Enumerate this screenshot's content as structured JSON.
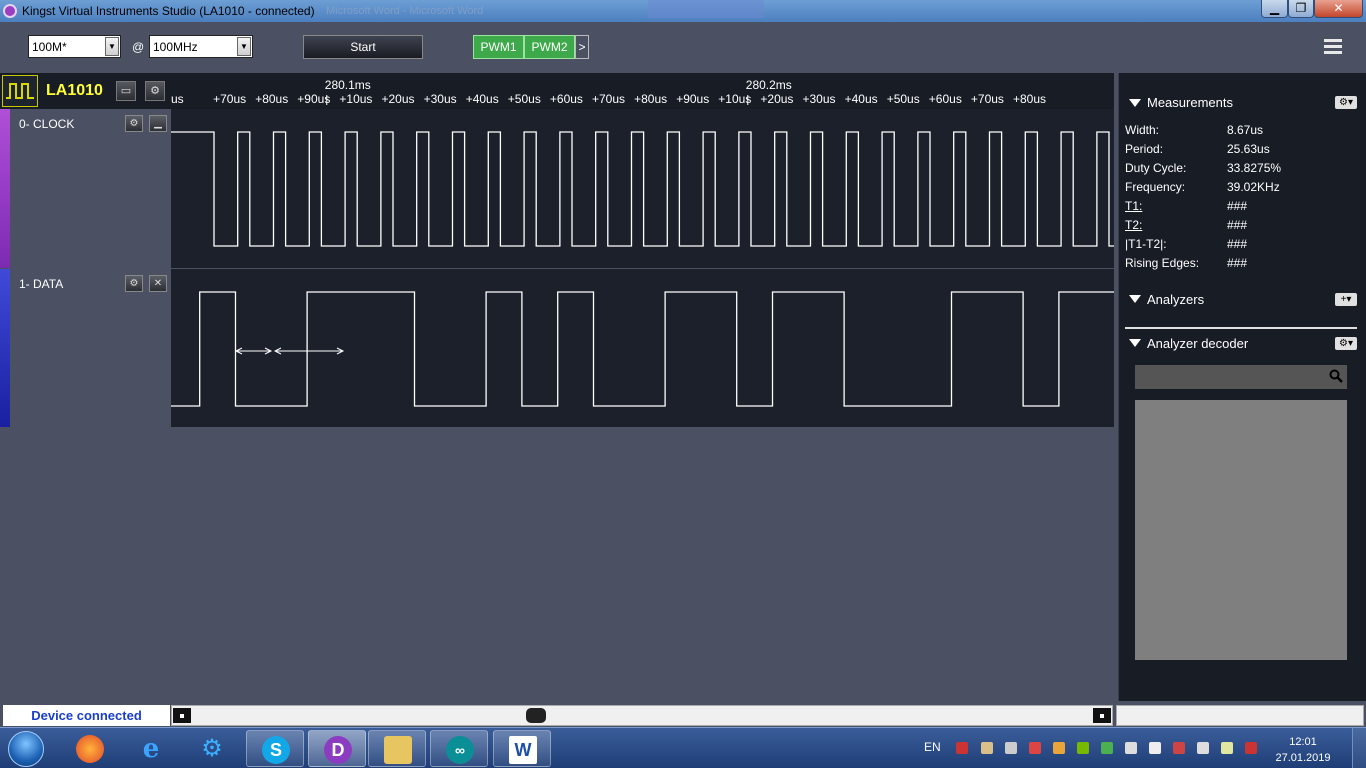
{
  "window": {
    "title": "Kingst Virtual Instruments Studio (LA1010 - connected)",
    "background_ghost_title": "Microsoft Word - Microsoft Word",
    "minimize_label": "▁",
    "maximize_label": "❐",
    "close_label": "✕"
  },
  "toolbar": {
    "sample_depth": "100M*",
    "at_label": "@",
    "sample_rate": "100MHz",
    "start_label": "Start",
    "pwm1_label": "PWM1",
    "pwm2_label": "PWM2",
    "more_label": ">"
  },
  "device": {
    "name": "LA1010"
  },
  "timeline": {
    "ticks": [
      "us",
      "+70us",
      "+80us",
      "+90us",
      "+10us",
      "+20us",
      "+30us",
      "+40us",
      "+50us",
      "+60us",
      "+70us",
      "+80us",
      "+90us",
      "+10us",
      "+20us",
      "+30us",
      "+40us",
      "+50us",
      "+60us",
      "+70us",
      "+80us"
    ],
    "major": [
      "280.1ms",
      "280.2ms"
    ]
  },
  "channels": [
    {
      "label": "0-  CLOCK",
      "color": "#9b3fc2"
    },
    {
      "label": "1-  DATA",
      "color": "#2a35c8"
    }
  ],
  "waveforms": {
    "clock": {
      "period_us": 25.63,
      "duty_cycle_pct": 33.8275
    },
    "data": {
      "levels": [
        0,
        1,
        0,
        0,
        1,
        1,
        1,
        0,
        0,
        1,
        0,
        1,
        0,
        0,
        1,
        1,
        0,
        1,
        1,
        0,
        0,
        0,
        1,
        1,
        0,
        1,
        1
      ]
    }
  },
  "measurements": {
    "title": "Measurements",
    "rows": [
      {
        "label": "Width:",
        "value": "8.67us"
      },
      {
        "label": "Period:",
        "value": "25.63us"
      },
      {
        "label": "Duty Cycle:",
        "value": "33.8275%"
      },
      {
        "label": "Frequency:",
        "value": "39.02KHz"
      },
      {
        "label": "T1:",
        "value": "###"
      },
      {
        "label": "T2:",
        "value": "###"
      },
      {
        "label": "|T1-T2|:",
        "value": "###"
      },
      {
        "label": "Rising Edges:",
        "value": "###"
      }
    ]
  },
  "analyzers": {
    "title": "Analyzers",
    "add_label": "+"
  },
  "decoder": {
    "title": "Analyzer decoder",
    "search_placeholder": ""
  },
  "status": {
    "text": "Device connected"
  },
  "taskbar": {
    "lang": "EN",
    "time": "12:01",
    "date": "27.01.2019"
  },
  "colors": {
    "accent_yellow": "#ffff33",
    "pwm_green": "#3ea94a",
    "status_blue": "#1a3fcc",
    "wave_bg": "#1b202a",
    "panel_bg": "#171c25"
  }
}
